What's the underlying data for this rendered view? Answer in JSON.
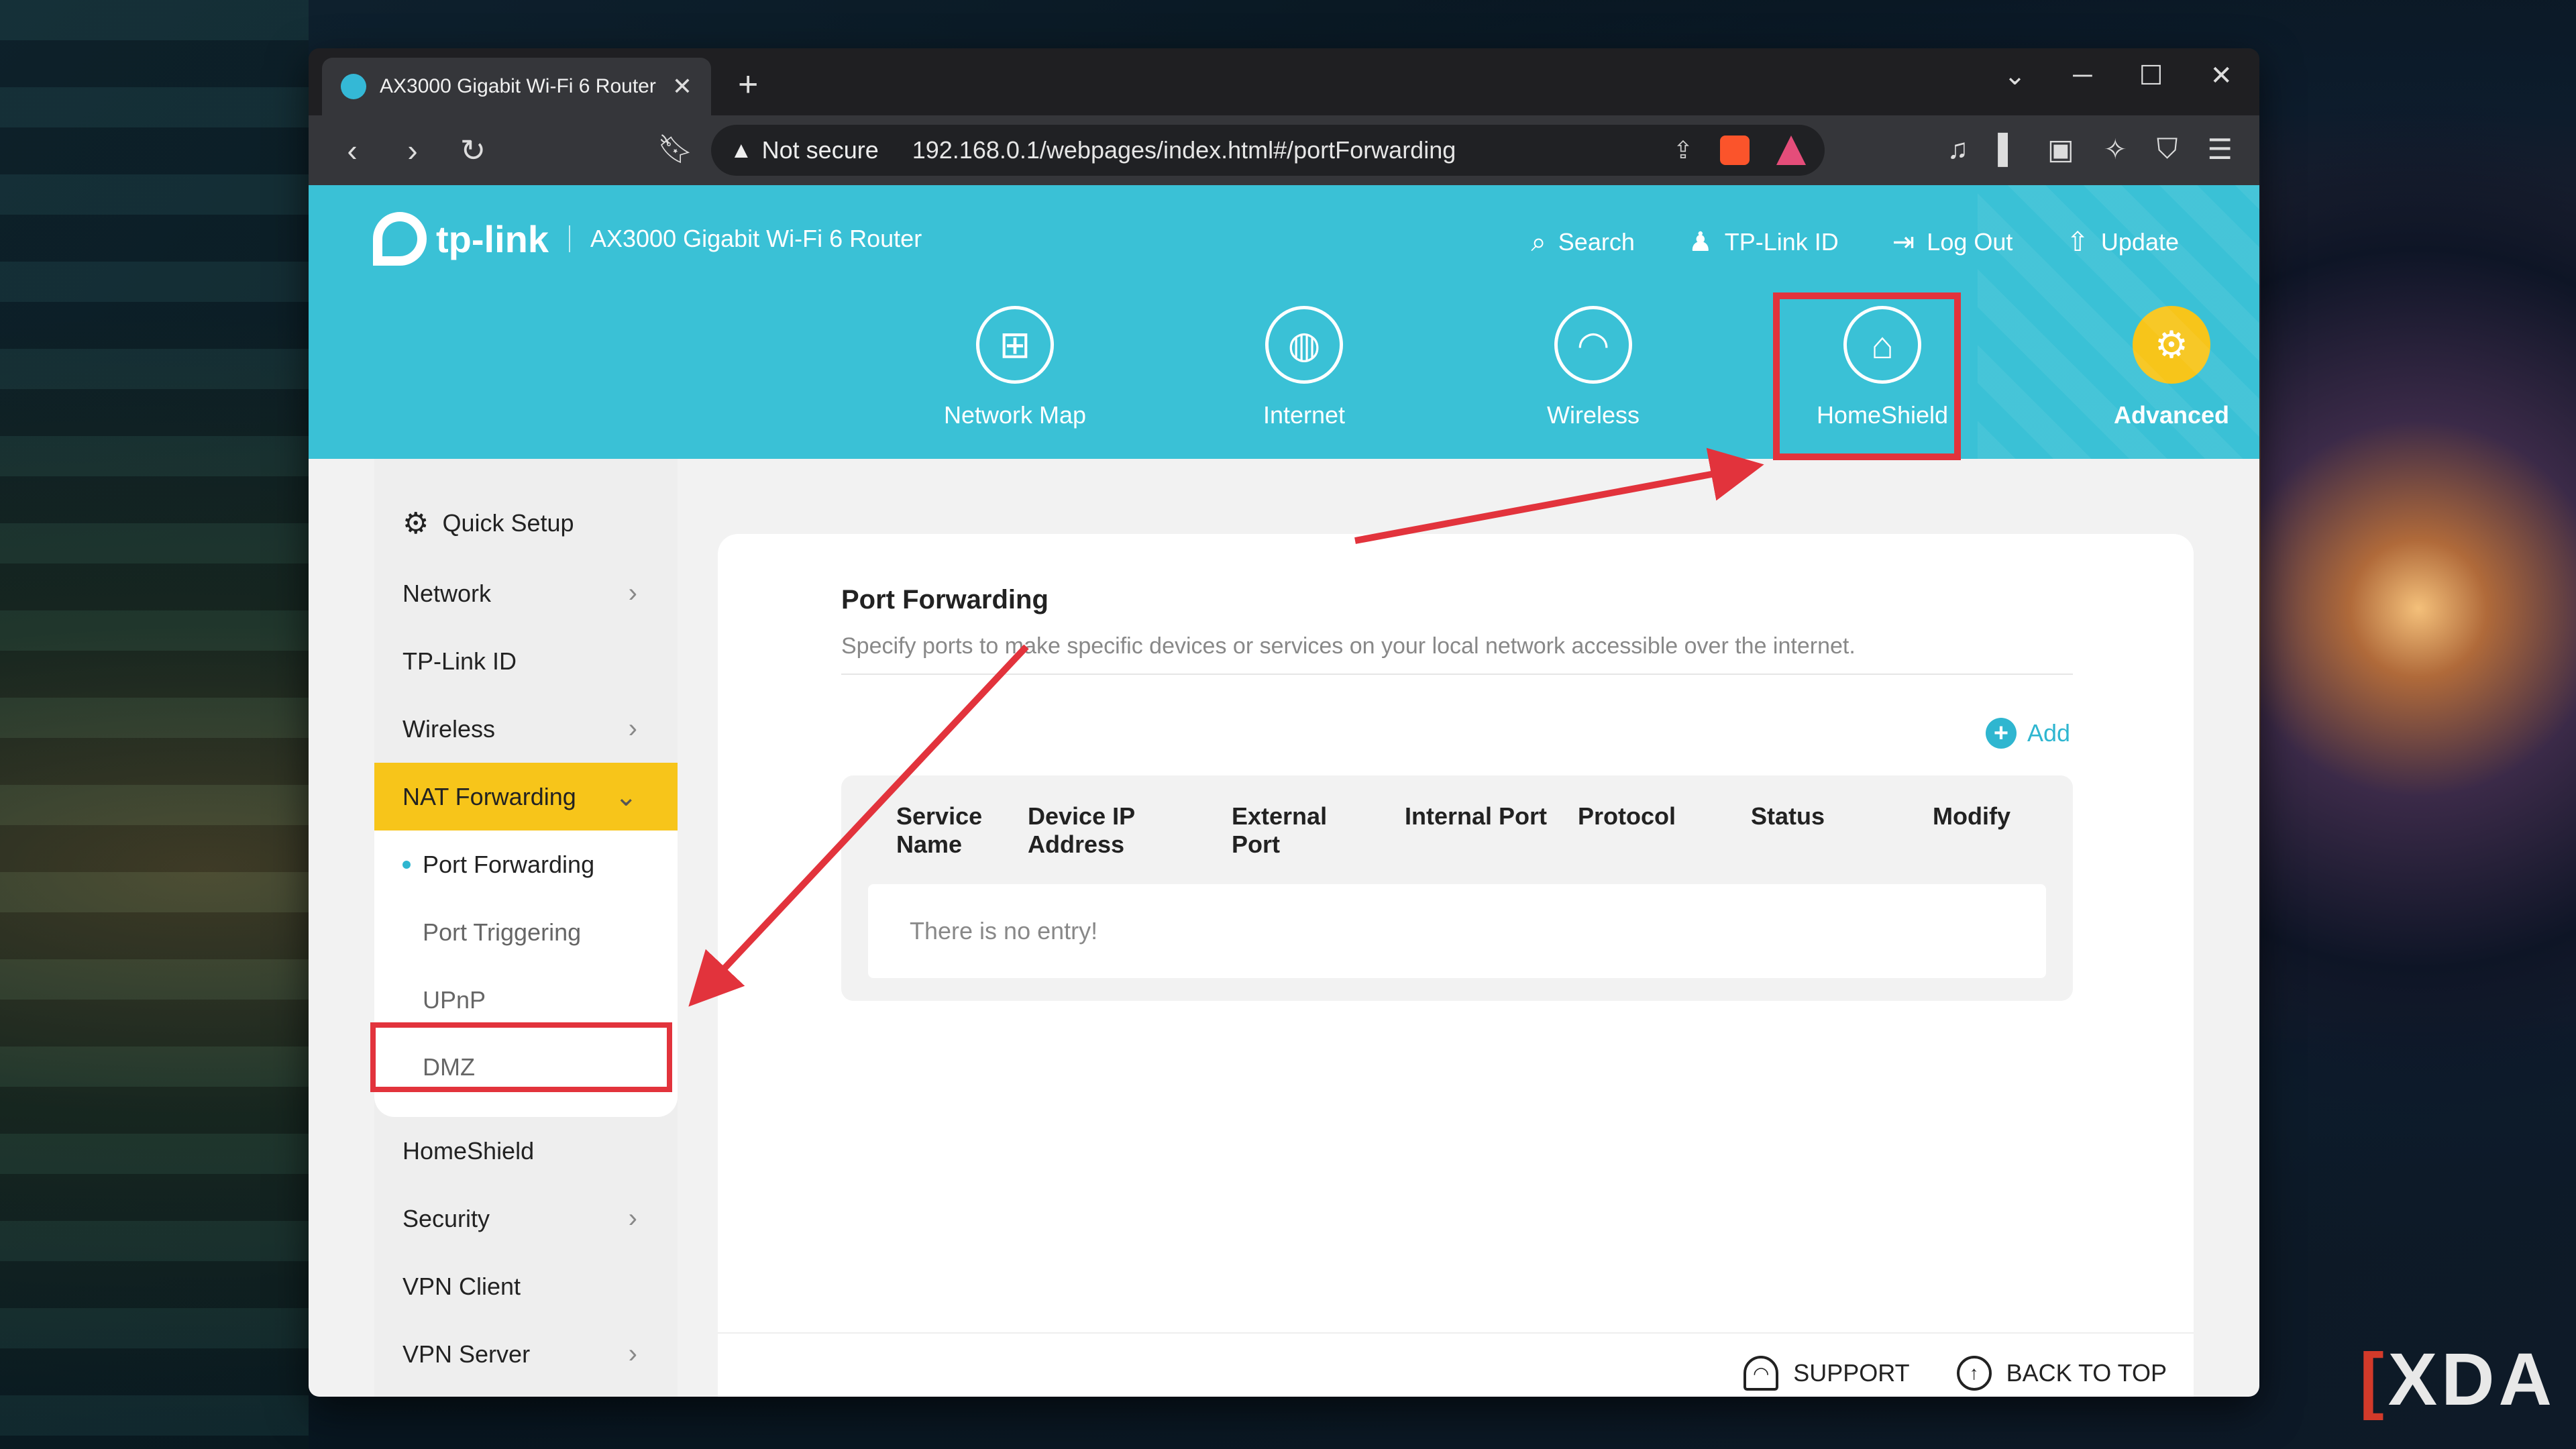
{
  "browser": {
    "tab_title": "AX3000 Gigabit Wi-Fi 6 Router",
    "new_tab": "+",
    "not_secure": "Not secure",
    "url": "192.168.0.1/webpages/index.html#/portForwarding"
  },
  "router": {
    "brand": "tp-link",
    "model": "AX3000 Gigabit Wi-Fi 6 Router",
    "header_links": {
      "search": "Search",
      "tplink_id": "TP-Link ID",
      "logout": "Log Out",
      "update": "Update"
    },
    "nav": {
      "network_map": "Network Map",
      "internet": "Internet",
      "wireless": "Wireless",
      "homeshield": "HomeShield",
      "advanced": "Advanced"
    }
  },
  "sidebar": {
    "quick_setup": "Quick Setup",
    "network": "Network",
    "tplink_id": "TP-Link ID",
    "wireless": "Wireless",
    "nat_forwarding": "NAT Forwarding",
    "sub": {
      "port_forwarding": "Port Forwarding",
      "port_triggering": "Port Triggering",
      "upnp": "UPnP",
      "dmz": "DMZ"
    },
    "homeshield": "HomeShield",
    "security": "Security",
    "vpn_client": "VPN Client",
    "vpn_server": "VPN Server"
  },
  "content": {
    "title": "Port Forwarding",
    "description": "Specify ports to make specific devices or services on your local network accessible over the internet.",
    "add": "Add",
    "columns": {
      "service_name_1": "Service",
      "service_name_2": "Name",
      "device_ip_1": "Device IP",
      "device_ip_2": "Address",
      "external_port_1": "External",
      "external_port_2": "Port",
      "internal_port": "Internal Port",
      "protocol": "Protocol",
      "status": "Status",
      "modify": "Modify"
    },
    "empty": "There is no entry!"
  },
  "footer": {
    "support": "SUPPORT",
    "back_to_top": "BACK TO TOP"
  },
  "watermark": "XDA",
  "colors": {
    "accent": "#3ac1d6",
    "active_nav": "#f7c51a",
    "highlight": "#e2333c"
  }
}
